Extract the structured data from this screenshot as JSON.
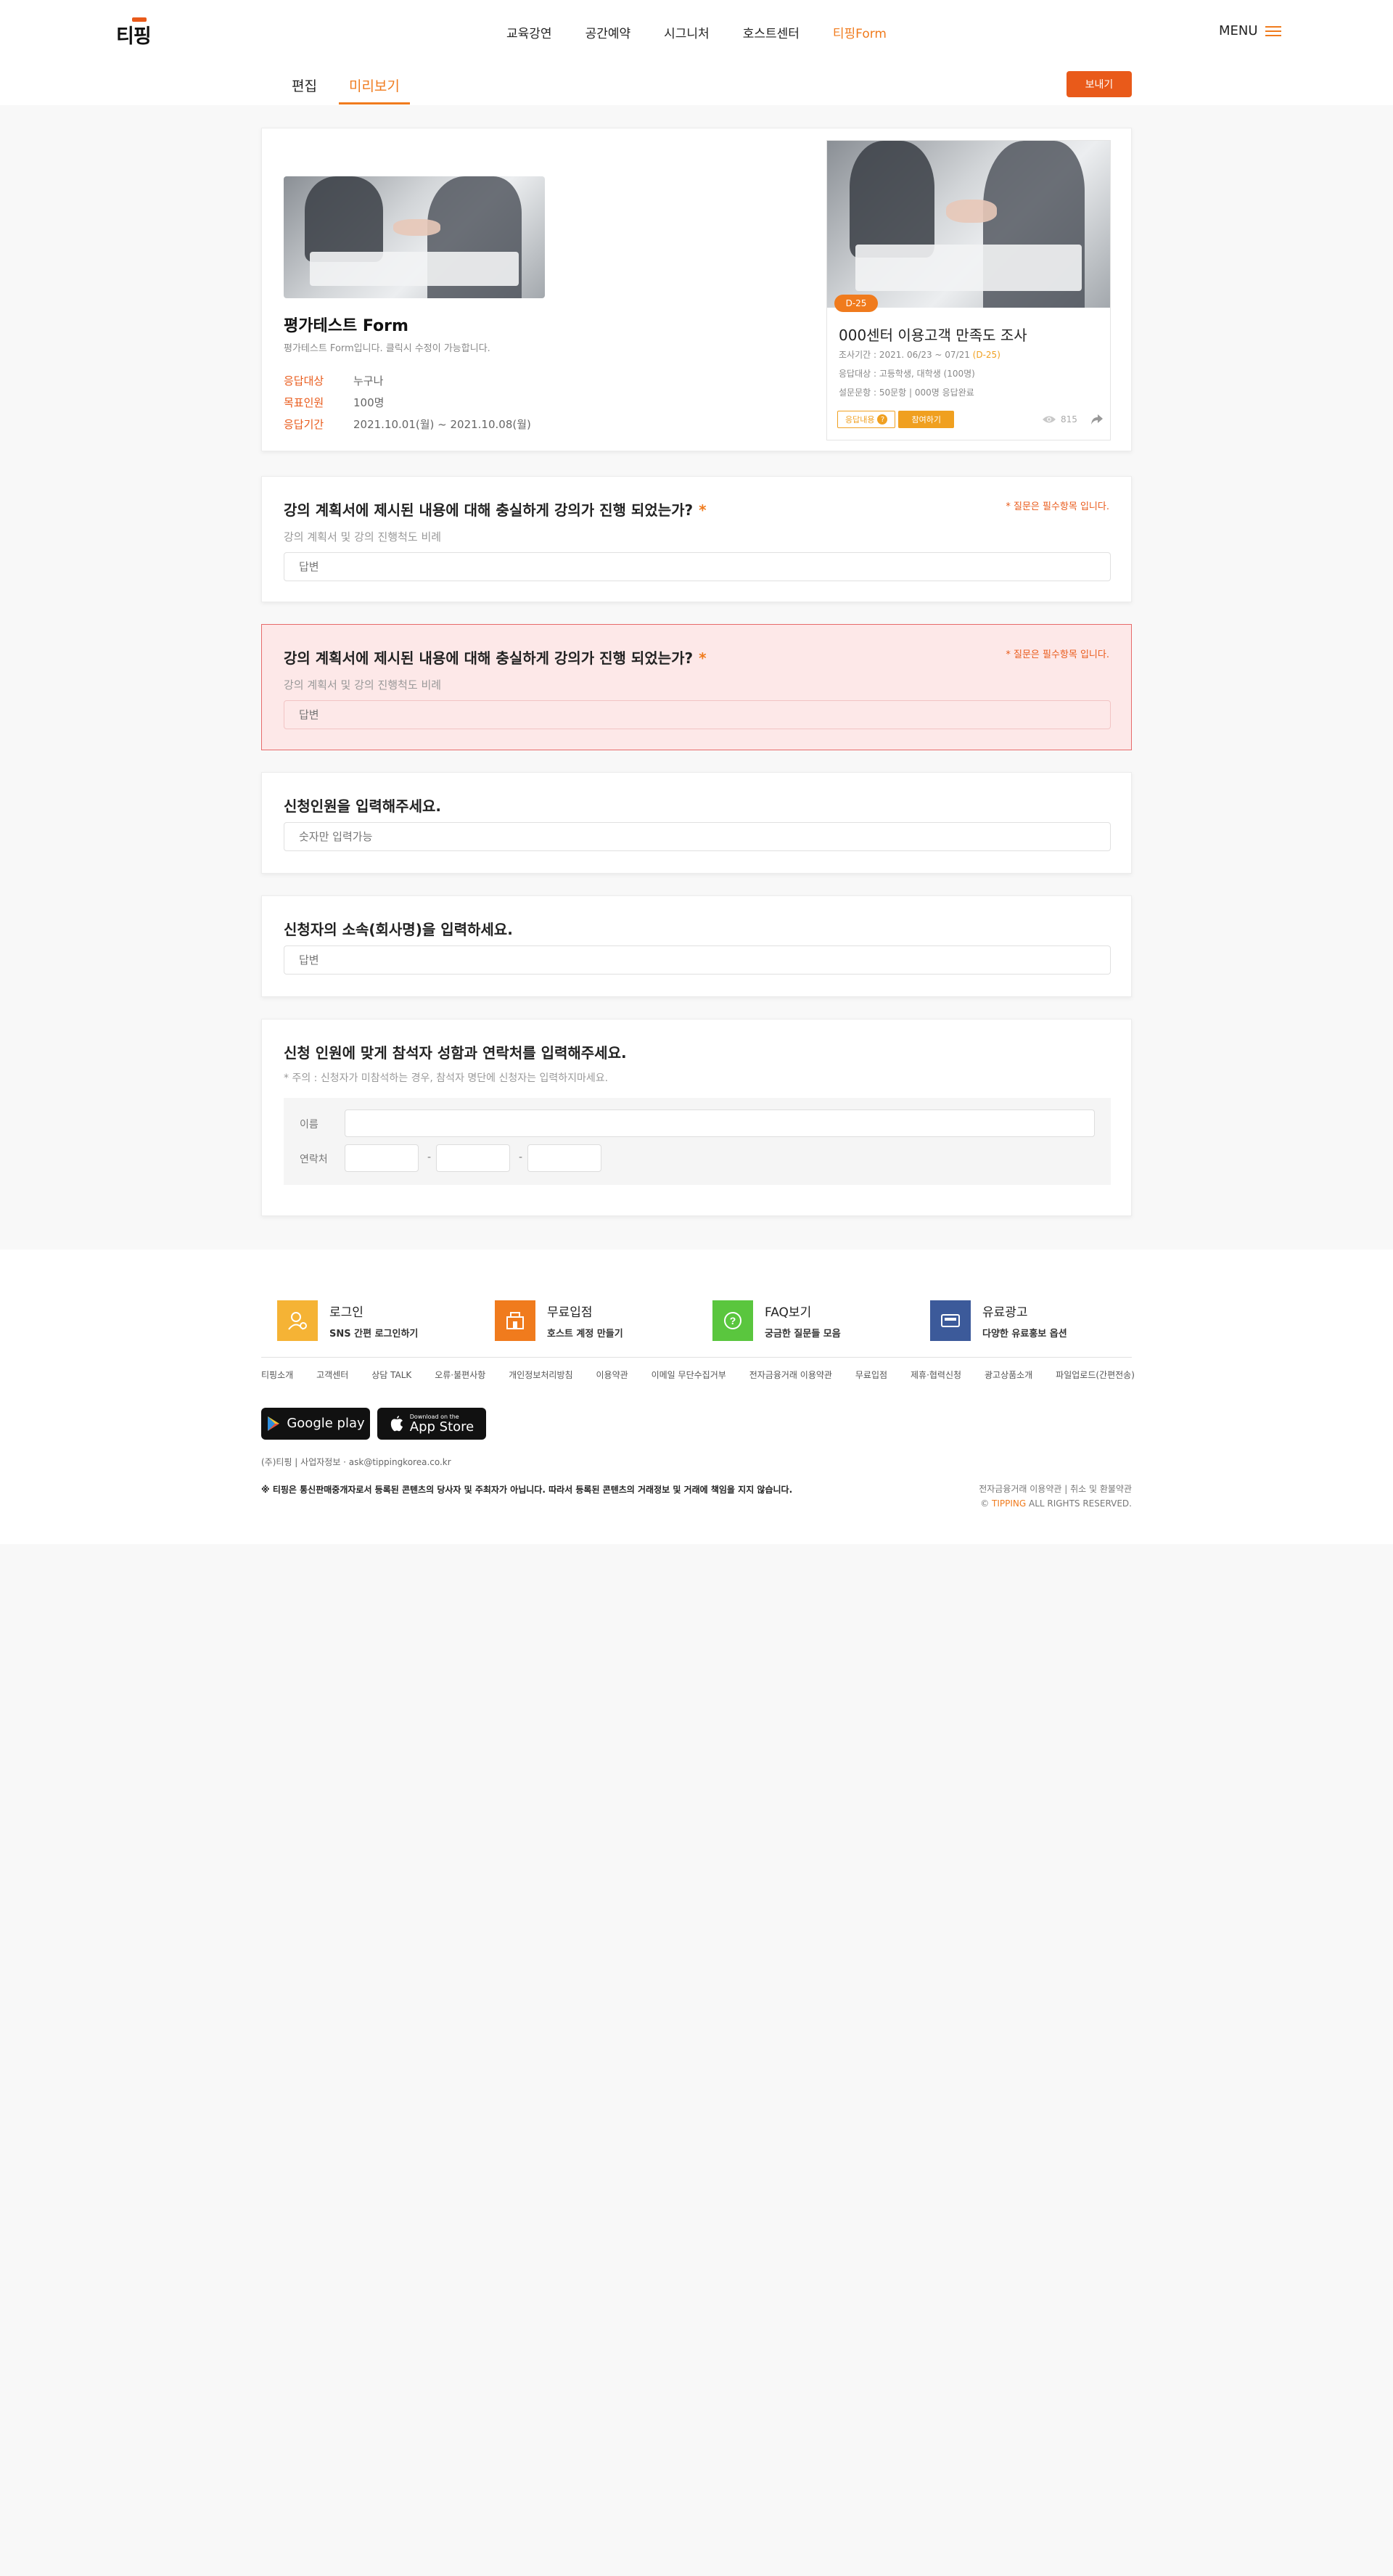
{
  "header": {
    "logo": "티핑",
    "nav": [
      "교육강연",
      "공간예약",
      "시그니처",
      "호스트센터",
      "티핑Form"
    ],
    "active_nav": "티핑Form",
    "menu_label": "MENU",
    "tabs": [
      "편집",
      "미리보기"
    ],
    "active_tab": "미리보기",
    "send_label": "보내기"
  },
  "form": {
    "title": "평가테스트 Form",
    "description": "평가테스트 Form입니다. 클릭시 수정이 가능합니다.",
    "meta": [
      {
        "label": "응답대상",
        "value": "누구나"
      },
      {
        "label": "목표인원",
        "value": "100명"
      },
      {
        "label": "응답기간",
        "value": "2021.10.01(월) ~ 2021.10.08(월)"
      }
    ]
  },
  "preview": {
    "badge": "D-25",
    "title": "000센터 이용고객 만족도 조사",
    "period_prefix": "조사기간 : 2021. 06/23 ~ 07/21 ",
    "period_highlight": "(D-25)",
    "target": "응답대상 : 고등학생, 대학생 (100명)",
    "count": "설문문항 : 50문항  |  000명 응답완료",
    "btn_reward": "응답내용",
    "btn_join": "참여하기",
    "views": "815"
  },
  "questions": [
    {
      "title": "강의 계획서에 제시된 내용에 대해 충실하게 강의가 진행 되었는가?",
      "star": "*",
      "required_note": "* 질문은 필수항목 입니다.",
      "sub": "강의 계획서 및 강의 진행척도 비례",
      "placeholder": "답변"
    },
    {
      "title": "강의 계획서에 제시된 내용에 대해 충실하게 강의가 진행 되었는가?",
      "star": "*",
      "required_note": "* 질문은 필수항목 입니다.",
      "sub": "강의 계획서 및 강의 진행척도 비례",
      "placeholder": "답변"
    },
    {
      "title": "신청인원을 입력해주세요.",
      "placeholder": "숫자만 입력가능"
    },
    {
      "title": "신청자의 소속(회사명)을 입력하세요.",
      "placeholder": "답변"
    },
    {
      "title": "신청 인원에 맞게 참석자 성함과 연락처를 입력해주세요.",
      "sub": "* 주의 : 신청자가 미참석하는 경우, 참석자 명단에 신청자는 입력하지마세요.",
      "name_label": "이름",
      "phone_label": "연락처",
      "dash": "-"
    }
  ],
  "footer": {
    "quick": [
      {
        "title": "로그인",
        "sub": "SNS 간편 로그인하기",
        "icon": "user-icon",
        "color": "#f5b335"
      },
      {
        "title": "무료입점",
        "sub": "호스트 계정 만들기",
        "icon": "store-icon",
        "color": "#f07b1d"
      },
      {
        "title": "FAQ보기",
        "sub": "궁금한 질문들 모음",
        "icon": "question-icon",
        "color": "#5ac63e"
      },
      {
        "title": "유료광고",
        "sub": "다양한 유료홍보 옵션",
        "icon": "ad-icon",
        "color": "#3c5a9a"
      }
    ],
    "links": [
      "티핑소개",
      "고객센터",
      "상담 TALK",
      "오류·불편사항",
      "개인정보처리방침",
      "이용약관",
      "이메일 무단수집거부",
      "전자금융거래 이용약관",
      "무료입점",
      "제휴·협력신청",
      "광고상품소개",
      "파일업로드(간편전송)"
    ],
    "google_play": "Google play",
    "app_store_small": "Download on the",
    "app_store_big": "App Store",
    "company": "(주)티핑  |  사업자정보  ·  ask@tippingkorea.co.kr",
    "notice": "※ 티핑은 통신판매중개자로서 등록된 콘텐츠의 당사자 및 주최자가 아닙니다. 따라서 등록된 콘텐츠의 거래정보 및 거래에 책임을 지지 않습니다.",
    "right_links": "전자금융거래 이용약관  |  취소 및 환불약관",
    "copyright_prefix": "© ",
    "copyright_brand": "TIPPING",
    "copyright_suffix": " ALL RIGHTS RESERVED."
  }
}
